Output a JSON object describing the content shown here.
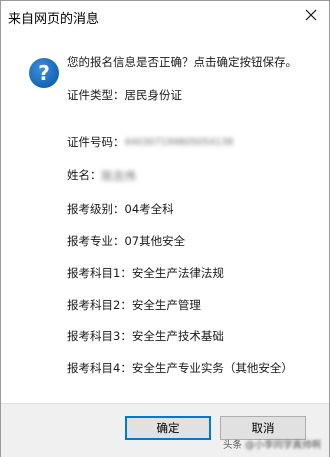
{
  "dialog": {
    "title": "来自网页的消息",
    "message": "您的报名信息是否正确？点击确定按钮保存。",
    "fields": [
      {
        "label": "证件类型：",
        "value": "居民身份证"
      },
      {
        "label": "证件号码：",
        "value": "440307199805054138"
      },
      {
        "label": "姓名：",
        "value": "陈志伟"
      },
      {
        "label": "报考级别：",
        "value": "04考全科"
      },
      {
        "label": "报考专业：",
        "value": "07其他安全"
      },
      {
        "label": "报考科目1：",
        "value": "安全生产法律法规"
      },
      {
        "label": "报考科目2：",
        "value": "安全生产管理"
      },
      {
        "label": "报考科目3：",
        "value": "安全生产技术基础"
      },
      {
        "label": "报考科目4：",
        "value": "安全生产专业实务（其他安全）"
      }
    ],
    "ok_label": "确定",
    "cancel_label": "取消"
  },
  "watermark": {
    "prefix": "头条",
    "handle": "@小李同学真帅啊"
  },
  "icons": {
    "dialog_icon": "question-icon",
    "close": "close-icon"
  },
  "colors": {
    "focus_border": "#0078d7",
    "question_icon": "#1565b6"
  }
}
